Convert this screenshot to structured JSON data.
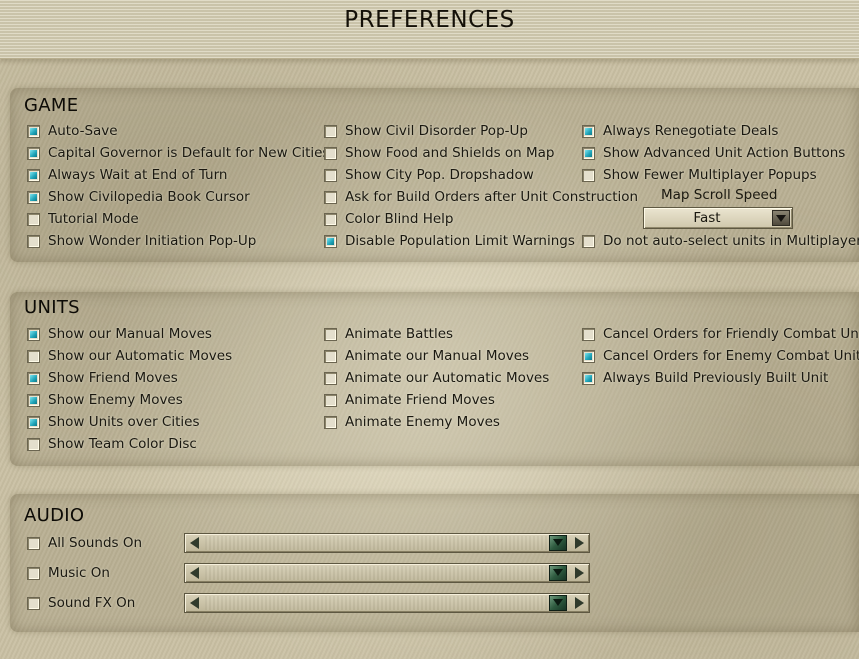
{
  "window": {
    "title": "PREFERENCES"
  },
  "game": {
    "title": "GAME",
    "options": [
      {
        "label": "Auto-Save",
        "checked": true
      },
      {
        "label": "Capital Governor is Default for New Cities",
        "checked": true
      },
      {
        "label": "Always Wait at End of Turn",
        "checked": true
      },
      {
        "label": "Show Civilopedia Book Cursor",
        "checked": true
      },
      {
        "label": "Tutorial Mode",
        "checked": false
      },
      {
        "label": "Show Wonder Initiation Pop-Up",
        "checked": false
      },
      {
        "label": "Show Civil Disorder Pop-Up",
        "checked": false
      },
      {
        "label": "Show Food and Shields on Map",
        "checked": false
      },
      {
        "label": "Show City Pop. Dropshadow",
        "checked": false
      },
      {
        "label": "Ask for Build Orders after Unit Construction",
        "checked": false
      },
      {
        "label": "Color Blind Help",
        "checked": false
      },
      {
        "label": "Disable Population Limit Warnings",
        "checked": true
      },
      {
        "label": "Always Renegotiate Deals",
        "checked": true
      },
      {
        "label": "Show Advanced Unit Action Buttons",
        "checked": true
      },
      {
        "label": "Show Fewer Multiplayer Popups",
        "checked": false
      },
      {
        "label": "Do not auto-select units in Multiplayer",
        "checked": false
      }
    ],
    "map_scroll_speed": {
      "label": "Map Scroll Speed",
      "value": "Fast"
    }
  },
  "units": {
    "title": "UNITS",
    "options": [
      {
        "label": "Show our Manual Moves",
        "checked": true
      },
      {
        "label": "Show our Automatic Moves",
        "checked": false
      },
      {
        "label": "Show Friend Moves",
        "checked": true
      },
      {
        "label": "Show Enemy Moves",
        "checked": true
      },
      {
        "label": "Show Units over Cities",
        "checked": true
      },
      {
        "label": "Show Team Color Disc",
        "checked": false
      },
      {
        "label": "Animate Battles",
        "checked": false
      },
      {
        "label": "Animate our Manual Moves",
        "checked": false
      },
      {
        "label": "Animate our Automatic Moves",
        "checked": false
      },
      {
        "label": "Animate Friend Moves",
        "checked": false
      },
      {
        "label": "Animate Enemy Moves",
        "checked": false
      },
      {
        "label": "Cancel Orders for Friendly Combat Unit",
        "checked": false
      },
      {
        "label": "Cancel Orders for Enemy Combat Unit",
        "checked": true
      },
      {
        "label": "Always Build Previously Built Unit",
        "checked": true
      }
    ]
  },
  "audio": {
    "title": "AUDIO",
    "options": [
      {
        "label": "All Sounds On",
        "checked": false,
        "level": 1.0
      },
      {
        "label": "Music On",
        "checked": false,
        "level": 1.0
      },
      {
        "label": "Sound FX On",
        "checked": false,
        "level": 1.0
      }
    ]
  },
  "colors": {
    "check_fill": "#1ea3b8",
    "slider_thumb": "#2d5a3f",
    "text": "#1a1810"
  }
}
